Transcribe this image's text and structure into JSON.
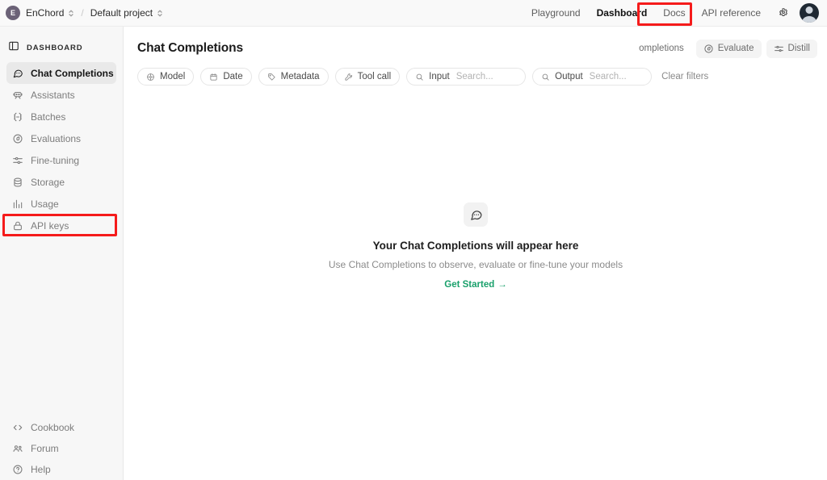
{
  "topbar": {
    "org_initial": "E",
    "org_name": "EnChord",
    "separator": "/",
    "project_name": "Default project",
    "nav": [
      {
        "label": "Playground",
        "active": false
      },
      {
        "label": "Dashboard",
        "active": true
      },
      {
        "label": "Docs",
        "active": false
      },
      {
        "label": "API reference",
        "active": false
      }
    ],
    "gear_icon": "gear-icon",
    "avatar_icon": "user-avatar"
  },
  "sidebar": {
    "section_label": "Dashboard",
    "section_icon": "panel-icon",
    "items": [
      {
        "label": "Chat Completions",
        "icon": "chat-bubble-icon",
        "active": true
      },
      {
        "label": "Assistants",
        "icon": "assistants-icon",
        "active": false
      },
      {
        "label": "Batches",
        "icon": "batches-icon",
        "active": false
      },
      {
        "label": "Evaluations",
        "icon": "evaluations-icon",
        "active": false
      },
      {
        "label": "Fine-tuning",
        "icon": "sliders-icon",
        "active": false
      },
      {
        "label": "Storage",
        "icon": "database-icon",
        "active": false
      },
      {
        "label": "Usage",
        "icon": "bar-chart-icon",
        "active": false
      },
      {
        "label": "API keys",
        "icon": "lock-icon",
        "active": false
      }
    ],
    "bottom_items": [
      {
        "label": "Cookbook",
        "icon": "code-icon"
      },
      {
        "label": "Forum",
        "icon": "people-icon"
      },
      {
        "label": "Help",
        "icon": "help-circle-icon"
      }
    ]
  },
  "main": {
    "title": "Chat Completions",
    "header_buttons": [
      {
        "label": "completions",
        "icon": "clipped-icon",
        "clipped": true
      },
      {
        "label": "Evaluate",
        "icon": "target-icon",
        "clipped": false
      },
      {
        "label": "Distill",
        "icon": "distill-icon",
        "clipped": false
      }
    ],
    "filters": [
      {
        "label": "Model",
        "icon": "model-icon",
        "type": "dropdown"
      },
      {
        "label": "Date",
        "icon": "calendar-icon",
        "type": "dropdown"
      },
      {
        "label": "Metadata",
        "icon": "tag-icon",
        "type": "dropdown"
      },
      {
        "label": "Tool call",
        "icon": "wrench-icon",
        "type": "dropdown"
      }
    ],
    "search_filters": [
      {
        "label": "Input",
        "placeholder": "Search...",
        "icon": "search-icon",
        "value": ""
      },
      {
        "label": "Output",
        "placeholder": "Search...",
        "icon": "search-icon",
        "value": ""
      }
    ],
    "clear_filters_label": "Clear filters"
  },
  "empty_state": {
    "icon": "chat-bubble-dots-icon",
    "title": "Your Chat Completions will appear here",
    "subtitle": "Use Chat Completions to observe, evaluate or fine-tune your models",
    "cta_label": "Get Started",
    "cta_arrow": "→"
  },
  "annotations": [
    {
      "name": "dashboard-highlight",
      "color": "#f51b1b",
      "target": "Dashboard"
    },
    {
      "name": "api-keys-highlight",
      "color": "#f51b1b",
      "target": "API keys"
    }
  ]
}
